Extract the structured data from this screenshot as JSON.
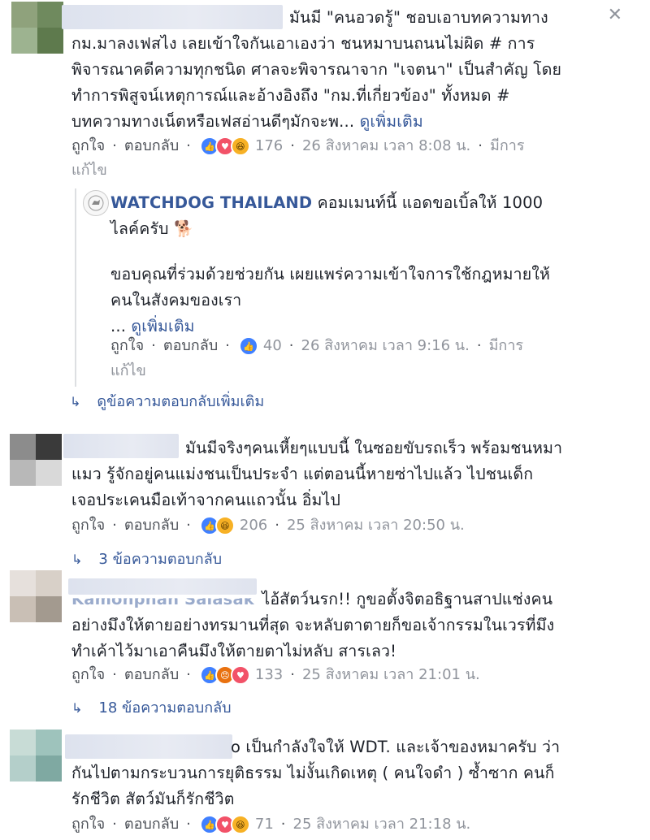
{
  "close_label": "✕",
  "comments": [
    {
      "lines": [
        {
          "pre": "",
          "text": "มันมี \"คนอวดรู้\" ชอบเอาบทความทาง"
        },
        {
          "pre": "",
          "text": "กม.มาลงเฟสไง เลยเข้าใจกันเอาเองว่า ชนหมาบนถนนไม่ผิด # การ"
        },
        {
          "pre": "",
          "text": "พิจารณาคดีความทุกชนิด ศาลจะพิจารณาจาก \"เจตนา\" เป็นสำคัญ โดย"
        },
        {
          "pre": "",
          "text": "ทำการพิสูจน์เหตุการณ์และอ้างอิงถึง \"กม.ที่เกี่ยวข้อง\" ทั้งหมด #"
        },
        {
          "pre": "",
          "text": "บทความทางเน็ตหรือเฟสอ่านดีๆมักจะพ..."
        }
      ],
      "see_more": "ดูเพิ่มเติม",
      "like": "ถูกใจ",
      "reply": "ตอบกลับ",
      "reaction_count": "176",
      "time": "26 สิงหาคม เวลา 8:08 น.",
      "edited": "มีการ",
      "edited_wrap": "แก้ไข",
      "reactions": [
        "like",
        "love",
        "haha"
      ]
    },
    {
      "page_name": "WATCHDOG THAILAND",
      "line1_rest": "คอมเมนท์นี้ แอดขอเบิ้ลให้ 1000",
      "line2": "ไลค์ครับ 🐕",
      "line3": "ขอบคุณที่ร่วมด้วยช่วยกัน เผยแพร่ความเข้าใจการใช้กฎหมายให้",
      "line4": "คนในสังคมของเรา",
      "ellipsis": "...",
      "see_more": "ดูเพิ่มเติม",
      "like": "ถูกใจ",
      "reply": "ตอบกลับ",
      "reaction_count": "40",
      "time": "26 สิงหาคม เวลา 9:16 น.",
      "edited": "มีการ",
      "edited_wrap": "แก้ไข",
      "reactions": [
        "like"
      ]
    },
    {
      "more_replies": "ดูข้อความตอบกลับเพิ่มเติม"
    },
    {
      "lines": [
        "มันมีจริงๆคนเหี้ยๆแบบนี้ ในซอยขับรถเร็ว พร้อมชนหมา",
        "แมว รู้จักอยู่คนแม่งชนเป็นประจำ แต่ตอนนี้หายซ่าไปแล้ว ไปชนเด็ก",
        "เจอประเคนมือเท้าจากคนแถวนั้น อิ่มไป"
      ],
      "like": "ถูกใจ",
      "reply": "ตอบกลับ",
      "reaction_count": "206",
      "time": "25 สิงหาคม เวลา 20:50 น.",
      "replies": "3 ข้อความตอบกลับ",
      "reactions": [
        "like",
        "haha"
      ]
    },
    {
      "name_partial": "Kamonphan Salasak",
      "lines": [
        "ไอ้สัตว์นรก!! กูขอตั้งจิตอธิฐานสาปแช่งคน",
        "อย่างมึงให้ตายอย่างทรมานที่สุด จะหลับตาตายก็ขอเจ้ากรรมในเวรที่มึง",
        "ทำเค้าไว้มาเอาคืนมึงให้ตายตาไม่หลับ สารเลว!"
      ],
      "like": "ถูกใจ",
      "reply": "ตอบกลับ",
      "reaction_count": "133",
      "time": "25 สิงหาคม เวลา 21:01 น.",
      "replies": "18 ข้อความตอบกลับ",
      "reactions": [
        "like",
        "angry",
        "love"
      ]
    },
    {
      "lines": [
        "o เป็นกำลังใจให้ WDT. และเจ้าของหมาครับ ว่า",
        "กันไปตามกระบวนการยุติธรรม ไม่งั้นเกิดเหตุ ( คนใจดำ ) ซ้ำซาก คนก็",
        "รักชีวิต สัตว์มันก็รักชีวิต"
      ],
      "like": "ถูกใจ",
      "reply": "ตอบกลับ",
      "reaction_count": "71",
      "time": "25 สิงหาคม เวลา 21:18 น.",
      "reactions": [
        "like",
        "love",
        "haha"
      ]
    }
  ],
  "colors": {
    "link": "#365899",
    "text": "#1d2129",
    "meta": "#90949c",
    "like_blue": "#4080ff",
    "love_red": "#f25268",
    "haha_yellow": "#f7b125"
  },
  "icons": [
    "close-icon",
    "reply-arrow-icon",
    "like-reaction-icon",
    "love-reaction-icon",
    "haha-reaction-icon",
    "angry-reaction-icon",
    "watchdog-logo-icon"
  ]
}
